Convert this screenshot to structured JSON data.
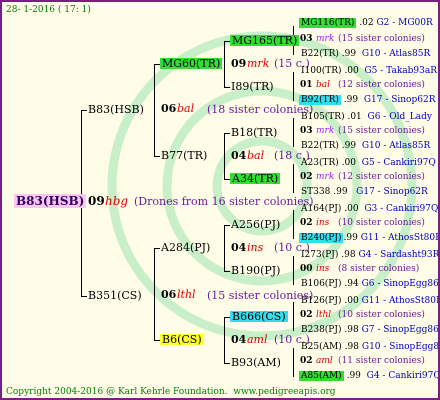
{
  "header": {
    "date": "28- 1-2016 ( 17: 1)"
  },
  "footer": {
    "copyright": "Copyright 2004-2016 @ Karl Kehrle Foundation.",
    "url": "www.pedigreeapis.org"
  },
  "colors": {
    "frame": "#7b1d84",
    "highlight_pink": "#f8c8f0",
    "highlight_green": "#33dd33",
    "highlight_cyan": "#33ddee",
    "highlight_yellow": "#ffff33"
  },
  "root": {
    "name": "B83(HSB)",
    "num": "09",
    "code": "hbg",
    "note": "(Drones from 16 sister colonies)"
  },
  "gen2": {
    "top": {
      "name": "B83(HSB)",
      "num": "06",
      "code": "bal",
      "note": "(18 sister colonies)"
    },
    "bottom": {
      "name": "B351(CS)",
      "num": "06",
      "code": "lthl",
      "note": "(15 sister colonies)"
    }
  },
  "gen3": [
    {
      "name": "MG60(TR)",
      "num": "09",
      "code": "mrk",
      "note": "(15 c.)"
    },
    {
      "name": "B77(TR)",
      "num": "04",
      "code": "bal",
      "note": "(18 c.)"
    },
    {
      "name": "A284(PJ)",
      "num": "04",
      "code": "ins",
      "note": "(10 c.)"
    },
    {
      "name": "B6(CS)",
      "num": "04",
      "code": "aml",
      "note": "(10 c.)"
    }
  ],
  "gen4": [
    {
      "name": "MG165(TR)",
      "num": "03",
      "code": "mrk",
      "note": "(15 sister colonies)"
    },
    {
      "name": "I89(TR)",
      "num": "01",
      "code": "bal",
      "note": "(12 sister colonies)"
    },
    {
      "name": "B18(TR)",
      "num": "03",
      "code": "mrk",
      "note": "(15 sister colonies)"
    },
    {
      "name": "A34(TR)",
      "num": "02",
      "code": "mrk",
      "note": "(12 sister colonies)"
    },
    {
      "name": "A256(PJ)",
      "num": "02",
      "code": "ins",
      "note": "(10 sister colonies)"
    },
    {
      "name": "B190(PJ)",
      "num": "00",
      "code": "ins",
      "note": "(8 sister colonies)"
    },
    {
      "name": "B666(CS)",
      "num": "02",
      "code": "lthl",
      "note": "(10 sister colonies)"
    },
    {
      "name": "B93(AM)",
      "num": "02",
      "code": "aml",
      "note": "(11 sister colonies)"
    }
  ],
  "gen5": [
    {
      "name": "MG116(TR)",
      "year": ".02",
      "ref": "G2 - MG00R"
    },
    {
      "name": "B22(TR)",
      "year": ".99",
      "ref": "G10 - Atlas85R"
    },
    {
      "name": "I100(TR)",
      "year": ".00",
      "ref": "G5 - Takab93aR"
    },
    {
      "name": "B92(TR)",
      "year": ".99",
      "ref": "G17 - Sinop62R"
    },
    {
      "name": "B105(TR)",
      "year": ".01",
      "ref": "G6 - Old_Lady"
    },
    {
      "name": "B22(TR)",
      "year": ".99",
      "ref": "G10 - Atlas85R"
    },
    {
      "name": "A23(TR)",
      "year": ".00",
      "ref": "G5 - Cankiri97Q"
    },
    {
      "name": "ST338",
      "year": ".99",
      "ref": "G17 - Sinop62R"
    },
    {
      "name": "A164(PJ)",
      "year": ".00",
      "ref": "G3 - Cankiri97Q"
    },
    {
      "name": "B240(PJ)",
      "year": ".99",
      "ref": "G11 - AthosSt80R"
    },
    {
      "name": "I273(PJ)",
      "year": ".98",
      "ref": "G4 - Sardasht93R"
    },
    {
      "name": "B106(PJ)",
      "year": ".94",
      "ref": "G6 - SinopEgg86R"
    },
    {
      "name": "B126(PJ)",
      "year": ".00",
      "ref": "G11 - AthosSt80R"
    },
    {
      "name": "B238(PJ)",
      "year": ".98",
      "ref": "G7 - SinopEgg86R"
    },
    {
      "name": "B25(AM)",
      "year": ".98",
      "ref": "G10 - SinopEgg86R"
    },
    {
      "name": "A85(AM)",
      "year": ".99",
      "ref": "G4 - Cankiri97Q"
    }
  ]
}
